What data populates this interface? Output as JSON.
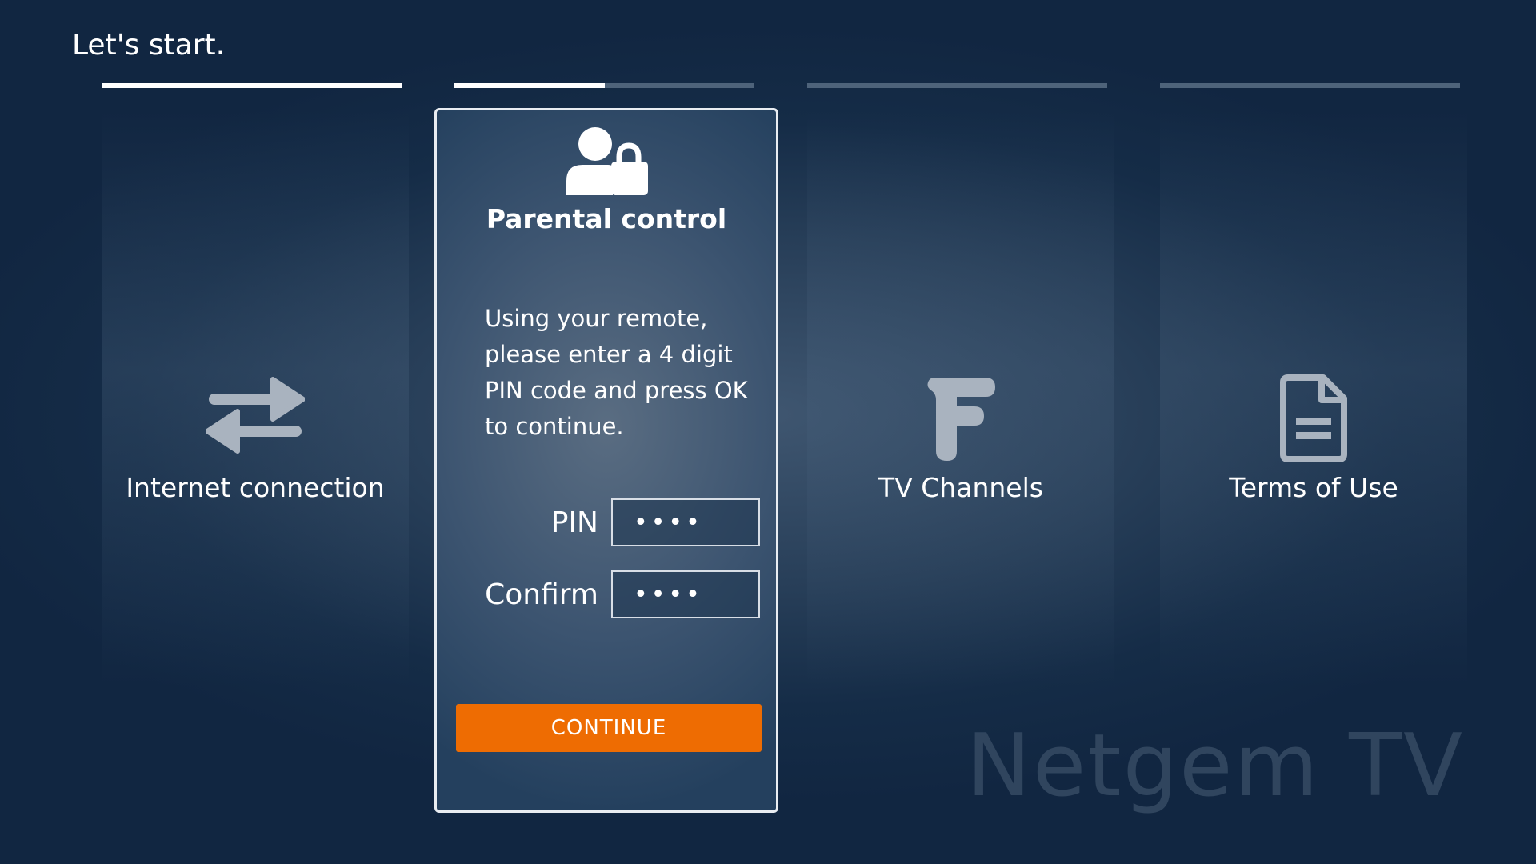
{
  "header": {
    "title": "Let's start."
  },
  "progress": [
    {
      "step": "internet-connection",
      "fill": 1.0
    },
    {
      "step": "parental-control",
      "fill": 0.5
    },
    {
      "step": "tv-channels",
      "fill": 0.0
    },
    {
      "step": "terms-of-use",
      "fill": 0.0
    }
  ],
  "steps": {
    "internet": {
      "label": "Internet connection",
      "icon": "arrows-exchange-icon"
    },
    "channels": {
      "label": "TV Channels",
      "icon": "netgem-logo-icon"
    },
    "terms": {
      "label": "Terms of Use",
      "icon": "document-icon"
    }
  },
  "parental": {
    "icon": "user-lock-icon",
    "title": "Parental control",
    "instructions": "Using your remote, please enter a 4 digit PIN code and press OK to continue.",
    "pin_label": "PIN",
    "pin_value": "••••",
    "confirm_label": "Confirm",
    "confirm_value": "••••",
    "continue_label": "CONTINUE"
  },
  "brand": {
    "watermark": "Netgem TV"
  },
  "colors": {
    "accent": "#ee6c02",
    "background": "#152c47",
    "progress_active": "#ffffff",
    "progress_inactive": "#4e637a",
    "icon_muted": "#a9b3bf"
  }
}
